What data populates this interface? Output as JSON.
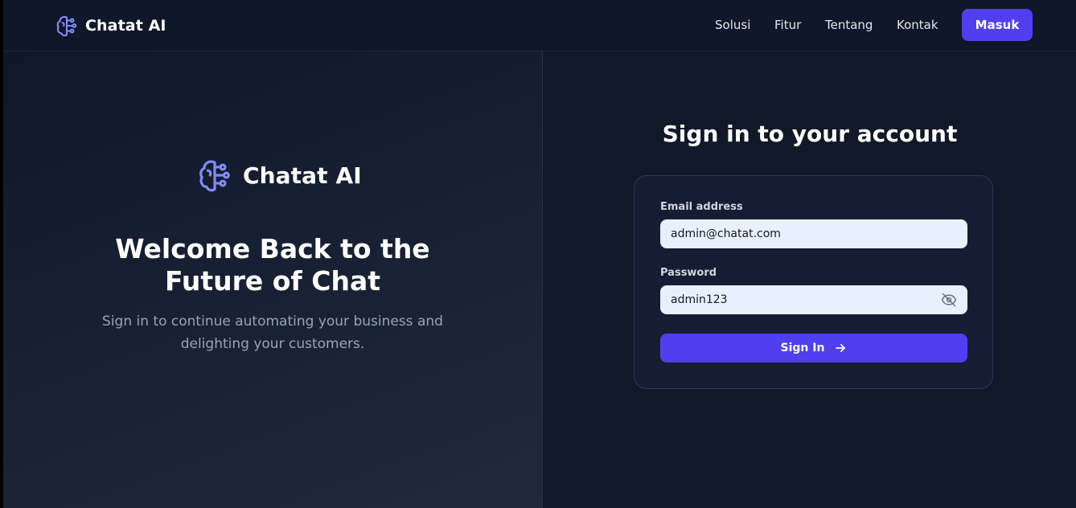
{
  "header": {
    "brand_name": "Chatat AI",
    "nav": [
      "Solusi",
      "Fitur",
      "Tentang",
      "Kontak"
    ],
    "login_label": "Masuk"
  },
  "hero": {
    "brand_name": "Chatat AI",
    "title_line1": "Welcome Back to the",
    "title_line2": "Future of Chat",
    "subtitle_line1": "Sign in to continue automating your business and",
    "subtitle_line2": "delighting your customers."
  },
  "signin": {
    "title": "Sign in to your account",
    "email_label": "Email address",
    "email_value": "admin@chatat.com",
    "password_label": "Password",
    "password_value": "admin123",
    "submit_label": "Sign In"
  },
  "icons": {
    "brand": "brain-icon",
    "password_toggle": "eye-off-icon",
    "submit": "arrow-right-icon"
  },
  "colors": {
    "accent": "#4f3ff0",
    "brand_icon": "#818cf8",
    "background": "#111827",
    "input_bg": "#e8f0fe"
  }
}
